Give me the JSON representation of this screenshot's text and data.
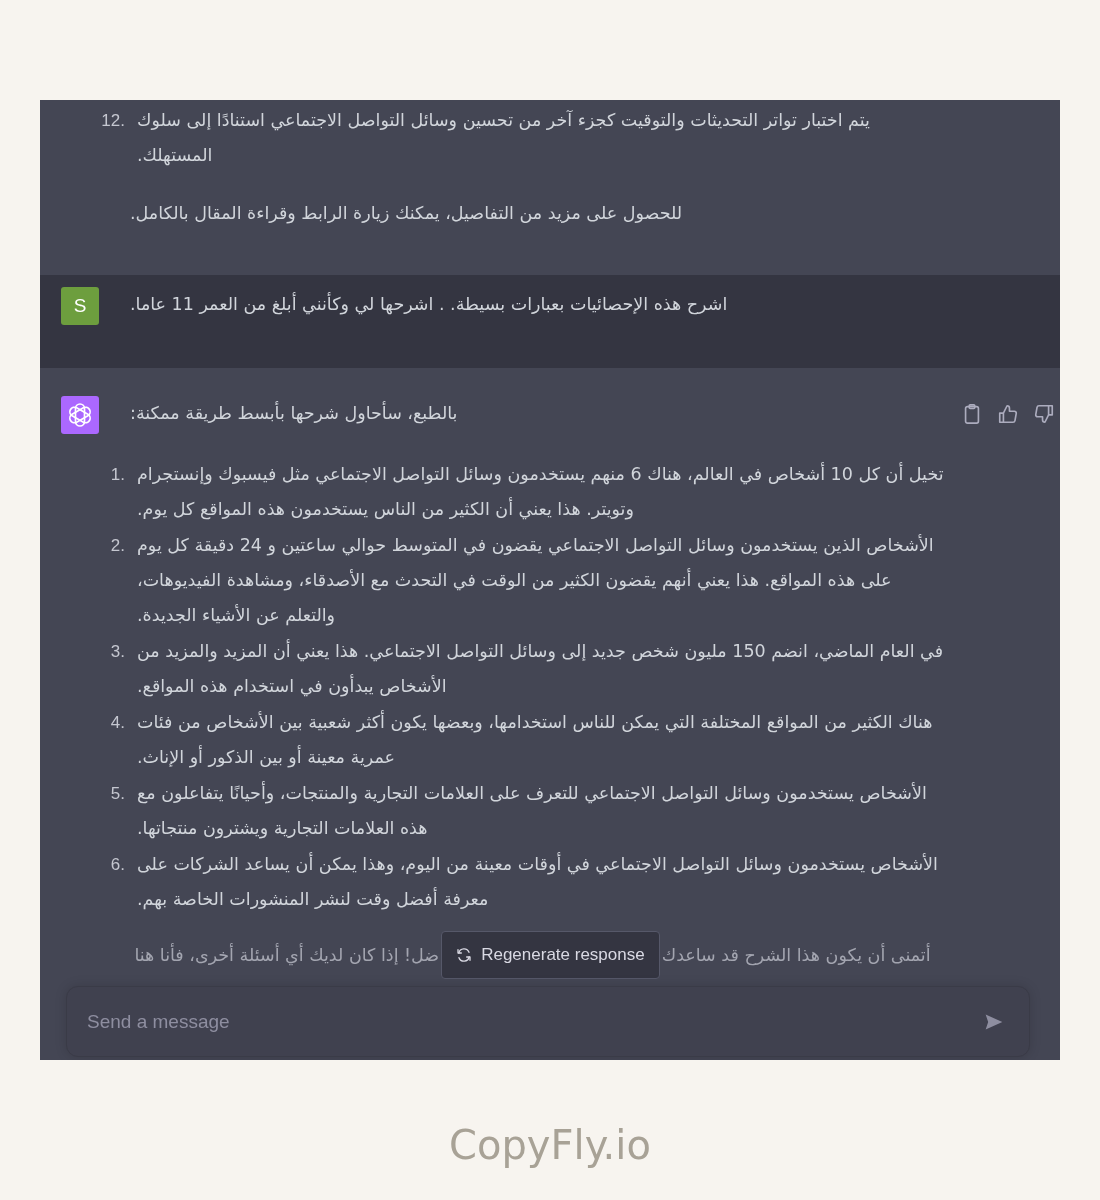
{
  "conversation": [
    {
      "kind": "assistant",
      "blocks": [
        {
          "kind": "list",
          "items": [
            {
              "number": "12.",
              "text": "يتم اختبار تواتر التحديثات والتوقيت كجزء آخر من تحسين وسائل التواصل الاجتماعي استنادًا إلى سلوك المستهلك."
            }
          ]
        },
        {
          "kind": "paragraph",
          "text": "للحصول على مزيد من التفاصيل، يمكنك زيارة الرابط وقراءة المقال بالكامل."
        }
      ]
    },
    {
      "kind": "user",
      "avatar": {
        "kind": "letter",
        "letter": "S"
      },
      "blocks": [
        {
          "kind": "paragraph",
          "text": "اشرح هذه الإحصائيات بعبارات بسيطة. . اشرحها لي وكأنني أبلغ من العمر 11 عاما."
        }
      ]
    },
    {
      "kind": "assistant",
      "avatar": {
        "kind": "logo"
      },
      "feedback_icons": true,
      "blocks": [
        {
          "kind": "paragraph",
          "text": "بالطبع، سأحاول شرحها بأبسط طريقة ممكنة:"
        },
        {
          "kind": "list",
          "items": [
            {
              "number": "1.",
              "text": "تخيل أن كل 10 أشخاص في العالم، هناك 6 منهم يستخدمون وسائل التواصل الاجتماعي مثل فيسبوك وإنستجرام وتويتر. هذا يعني أن الكثير من الناس يستخدمون هذه المواقع كل يوم."
            },
            {
              "number": "2.",
              "text": "الأشخاص الذين يستخدمون وسائل التواصل الاجتماعي يقضون في المتوسط حوالي ساعتين و 24 دقيقة كل يوم على هذه المواقع. هذا يعني أنهم يقضون الكثير من الوقت في التحدث مع الأصدقاء، ومشاهدة الفيديوهات، والتعلم عن الأشياء الجديدة."
            },
            {
              "number": "3.",
              "text": "في العام الماضي، انضم 150 مليون شخص جديد إلى وسائل التواصل الاجتماعي. هذا يعني أن المزيد والمزيد من الأشخاص يبدأون في استخدام هذه المواقع."
            },
            {
              "number": "4.",
              "text": "هناك الكثير من المواقع المختلفة التي يمكن للناس استخدامها، وبعضها يكون أكثر شعبية بين الأشخاص من فئات عمرية معينة أو بين الذكور أو الإناث."
            },
            {
              "number": "5.",
              "text": "الأشخاص يستخدمون وسائل التواصل الاجتماعي للتعرف على العلامات التجارية والمنتجات، وأحيانًا يتفاعلون مع هذه العلامات التجارية ويشترون منتجاتها."
            },
            {
              "number": "6.",
              "text": "الأشخاص يستخدمون وسائل التواصل الاجتماعي في أوقات معينة من اليوم، وهذا يمكن أن يساعد الشركات على معرفة أفضل وقت لنشر المنشورات الخاصة بهم."
            }
          ]
        },
        {
          "kind": "covered_paragraph",
          "start": "أتمنى أن يكون هذا الشرح قد ساعدك",
          "end": "ضل! إذا كان لديك أي أسئلة أخرى، فأنا هنا"
        }
      ]
    }
  ],
  "regenerate_button": {
    "label": "Regenerate response"
  },
  "message_input": {
    "placeholder": "Send a message"
  },
  "footer_brand": "CopyFly.io"
}
